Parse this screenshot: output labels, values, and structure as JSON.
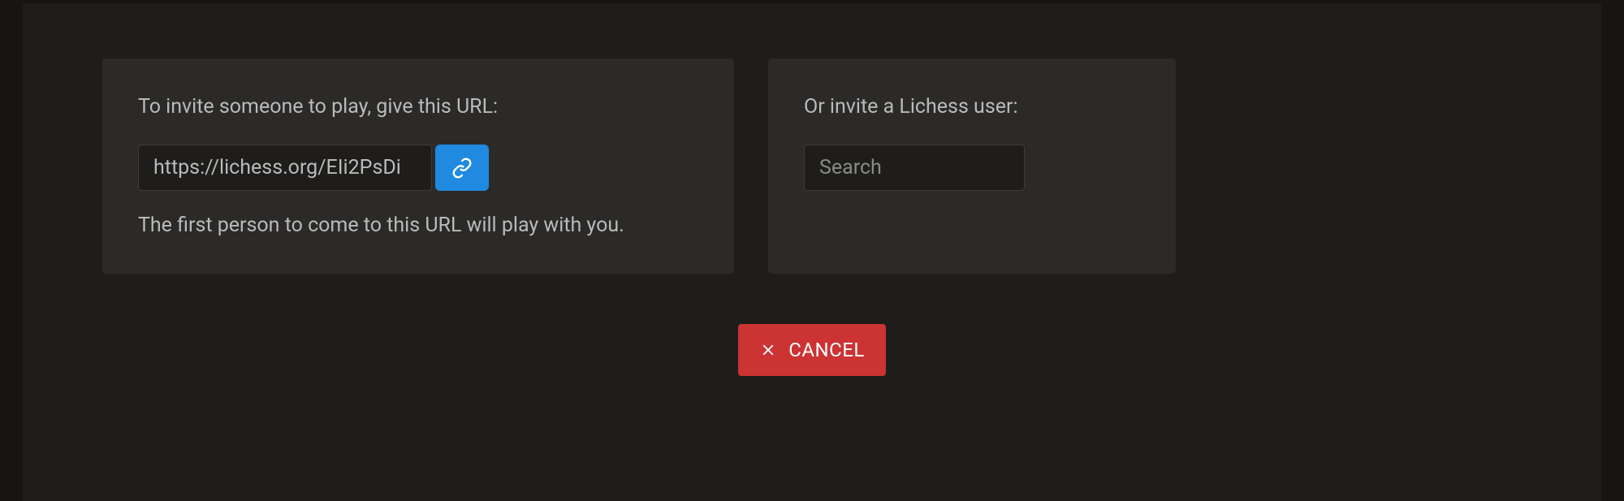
{
  "invite_panel": {
    "heading": "To invite someone to play, give this URL:",
    "url_value": "https://lichess.org/EIi2PsDi",
    "info_text": "The first person to come to this URL will play with you."
  },
  "user_panel": {
    "heading": "Or invite a Lichess user:",
    "search_placeholder": "Search"
  },
  "cancel_button": {
    "label": "CANCEL"
  }
}
